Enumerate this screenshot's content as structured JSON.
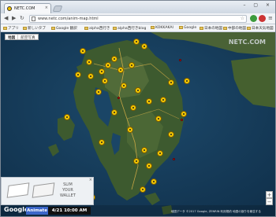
{
  "browser": {
    "tab_title": "NETC.COM",
    "tab_close": "×",
    "window_controls": "– ▢ ×",
    "url": "www.netc.com/anim-map.html",
    "nav": {
      "back": "◀",
      "forward": "▶",
      "reload": "↻"
    }
  },
  "bookmarks": [
    "アプリ",
    "新しいタブ",
    "Google 翻訳",
    "alpha西行き",
    "alpha西行きblog",
    "KOKKAKAI",
    "Google",
    "日本の地図",
    "中部の地図",
    "日本天気地図"
  ],
  "map": {
    "type_buttons": [
      "地図",
      "航空写真"
    ],
    "logo": "NETC.COM",
    "provider": "Google",
    "copyright": "地図データ ©2017 Google, ZENRIN 利用規約 地図の誤りを報告する",
    "zoom_in": "+",
    "zoom_out": "−"
  },
  "ad": {
    "line1": "SLIM",
    "line2": "YOUR",
    "line3": "WALLET",
    "close": "×"
  },
  "animation": {
    "button_label": "Animate",
    "time": "4/21 10:00 AM"
  },
  "colors": {
    "marker": "#f4c800",
    "animate_button": "#3b66c9",
    "sea": "#143a58",
    "land": "#3d5a2f"
  }
}
